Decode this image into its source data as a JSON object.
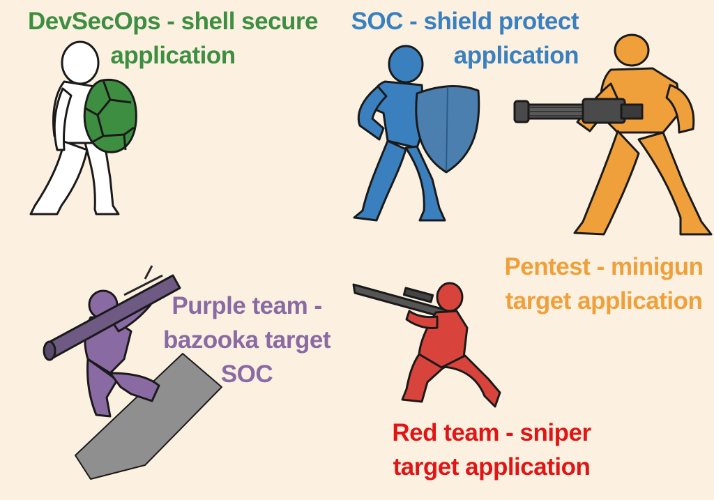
{
  "captions": {
    "devsecops": {
      "line1": "DevSecOps - shell secure",
      "line2": "application",
      "color": "#3e8e41"
    },
    "soc": {
      "line1": "SOC - shield protect",
      "line2": "application",
      "color": "#3a80bf"
    },
    "pentest": {
      "line1": "Pentest - minigun",
      "line2": "target application",
      "color": "#f0a03a"
    },
    "purple": {
      "line1": "Purple team -",
      "line2": "bazooka target",
      "line3": "SOC",
      "color": "#8a6aa3"
    },
    "red": {
      "line1": "Red team - sniper",
      "line2": "target application",
      "color": "#e01515"
    }
  },
  "figures": {
    "devsecops": {
      "icon": "turtle-shell-figure-icon",
      "body_color": "#ffffff",
      "shell_color": "#3e8e41"
    },
    "soc": {
      "icon": "shield-figure-icon",
      "body_color": "#3a80bf",
      "shield_color": "#4a7fb0"
    },
    "pentest": {
      "icon": "minigun-figure-icon",
      "body_color": "#f0a03a",
      "gun_color": "#4a4a4a"
    },
    "purple": {
      "icon": "bazooka-figure-icon",
      "body_color": "#8a6aa3",
      "ramp_color": "#8f8f8f"
    },
    "red": {
      "icon": "sniper-figure-icon",
      "body_color": "#d8443c",
      "rifle_color": "#555555"
    }
  }
}
